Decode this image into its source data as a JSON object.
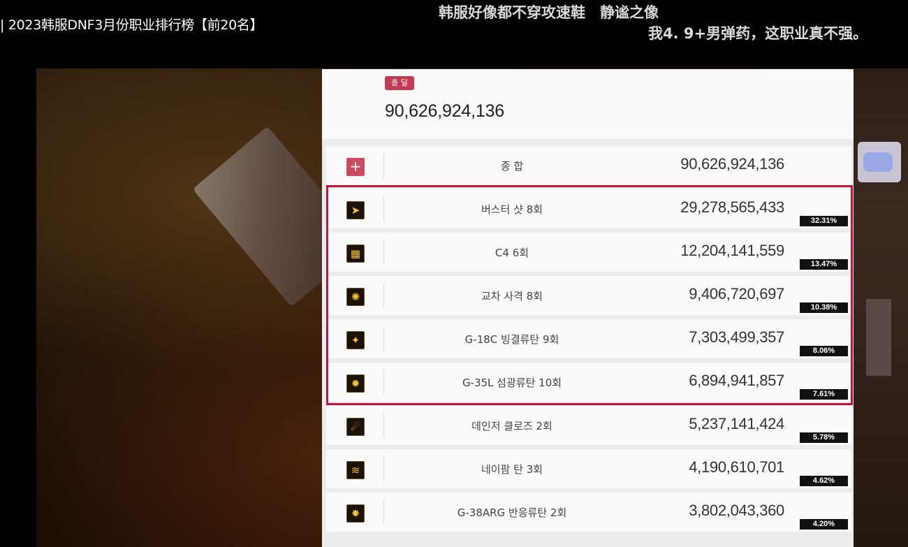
{
  "header": {
    "video_title": "| 2023韩服DNF3月份职业排行榜【前20名】"
  },
  "danmaku": [
    "韩服好像都不穿攻速鞋　静谧之像",
    "我4. 9+男弹药，这职业真不强。"
  ],
  "summary": {
    "badge": "총 딜",
    "total": "90,626,924,136"
  },
  "total_row": {
    "name": "종 합",
    "value": "90,626,924,136",
    "icon": "plus-icon"
  },
  "skills": [
    {
      "name": "버스터 샷 8회",
      "value": "29,278,565,433",
      "percent": "32.31%",
      "icon": "buster-shot-icon",
      "glyph": "➤"
    },
    {
      "name": "C4 6회",
      "value": "12,204,141,559",
      "percent": "13.47%",
      "icon": "c4-icon",
      "glyph": "▦"
    },
    {
      "name": "교차 사격 8회",
      "value": "9,406,720,697",
      "percent": "10.38%",
      "icon": "cross-fire-icon",
      "glyph": "✺"
    },
    {
      "name": "G-18C 빙결류탄 9회",
      "value": "7,303,499,357",
      "percent": "8.06%",
      "icon": "freeze-grenade-icon",
      "glyph": "✦"
    },
    {
      "name": "G-35L 섬광류탄 10회",
      "value": "6,894,941,857",
      "percent": "7.61%",
      "icon": "flash-grenade-icon",
      "glyph": "✹"
    },
    {
      "name": "데인저 클로즈 2회",
      "value": "5,237,141,424",
      "percent": "5.78%",
      "icon": "danger-close-icon",
      "glyph": "☄"
    },
    {
      "name": "네이팜 탄 3회",
      "value": "4,190,610,701",
      "percent": "4.62%",
      "icon": "napalm-icon",
      "glyph": "≋"
    },
    {
      "name": "G-38ARG 반응류탄 2회",
      "value": "3,802,043,360",
      "percent": "4.20%",
      "icon": "reactive-grenade-icon",
      "glyph": "✸"
    }
  ],
  "colors": {
    "accent": "#c0163c",
    "badge": "#c43a55",
    "panel_bg": "#ececec"
  }
}
